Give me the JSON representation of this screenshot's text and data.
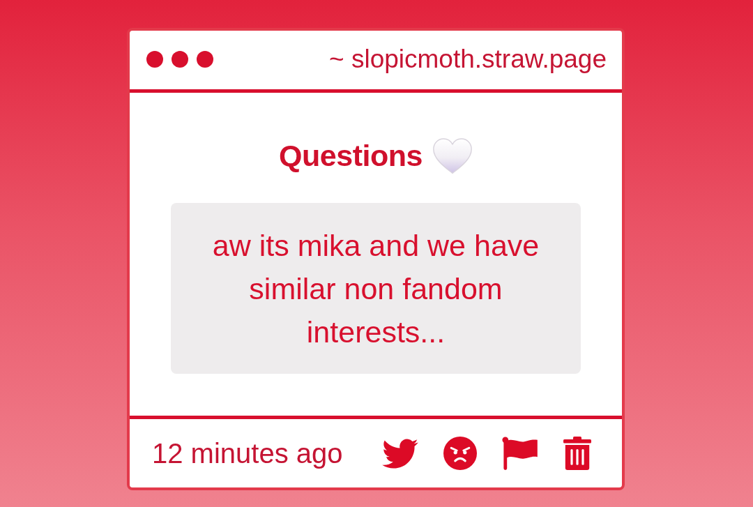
{
  "window": {
    "url": "~ slopicmoth.straw.page"
  },
  "section": {
    "title": "Questions"
  },
  "question": {
    "text": "aw its mika and we have similar non fandom interests..."
  },
  "footer": {
    "time": "12 minutes ago",
    "actions": [
      {
        "kind": "share"
      },
      {
        "kind": "react"
      },
      {
        "kind": "report"
      },
      {
        "kind": "delete"
      }
    ]
  }
}
